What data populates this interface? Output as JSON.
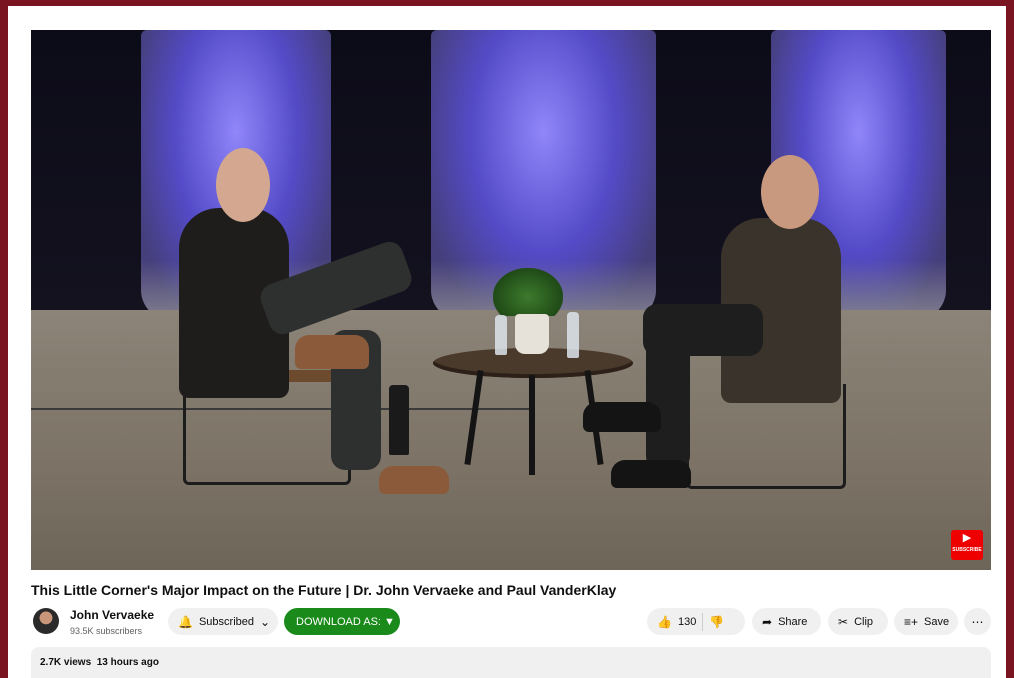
{
  "video": {
    "subscribe_watermark": "SUBSCRIBE"
  },
  "title": "This Little Corner's Major Impact on the Future | Dr. John Vervaeke and Paul VanderKlay",
  "channel": {
    "name": "John Vervaeke",
    "subscribers": "93.5K subscribers"
  },
  "actions": {
    "subscribed_label": "Subscribed",
    "download_label": "DOWNLOAD AS: ▼",
    "like_count": "130",
    "share_label": "Share",
    "clip_label": "Clip",
    "save_label": "Save"
  },
  "description": {
    "views": "2.7K views",
    "age": "13 hours ago"
  },
  "icons": {
    "bell": "bell-icon",
    "chevron": "chevron-down-icon",
    "like": "thumbs-up-icon",
    "dislike": "thumbs-down-icon",
    "share": "share-icon",
    "clip": "scissors-icon",
    "save": "playlist-add-icon",
    "more": "more-horizontal-icon"
  },
  "colors": {
    "frame": "#7a1420",
    "download_button": "#1a8a1a",
    "youtube_red": "#e00000"
  }
}
